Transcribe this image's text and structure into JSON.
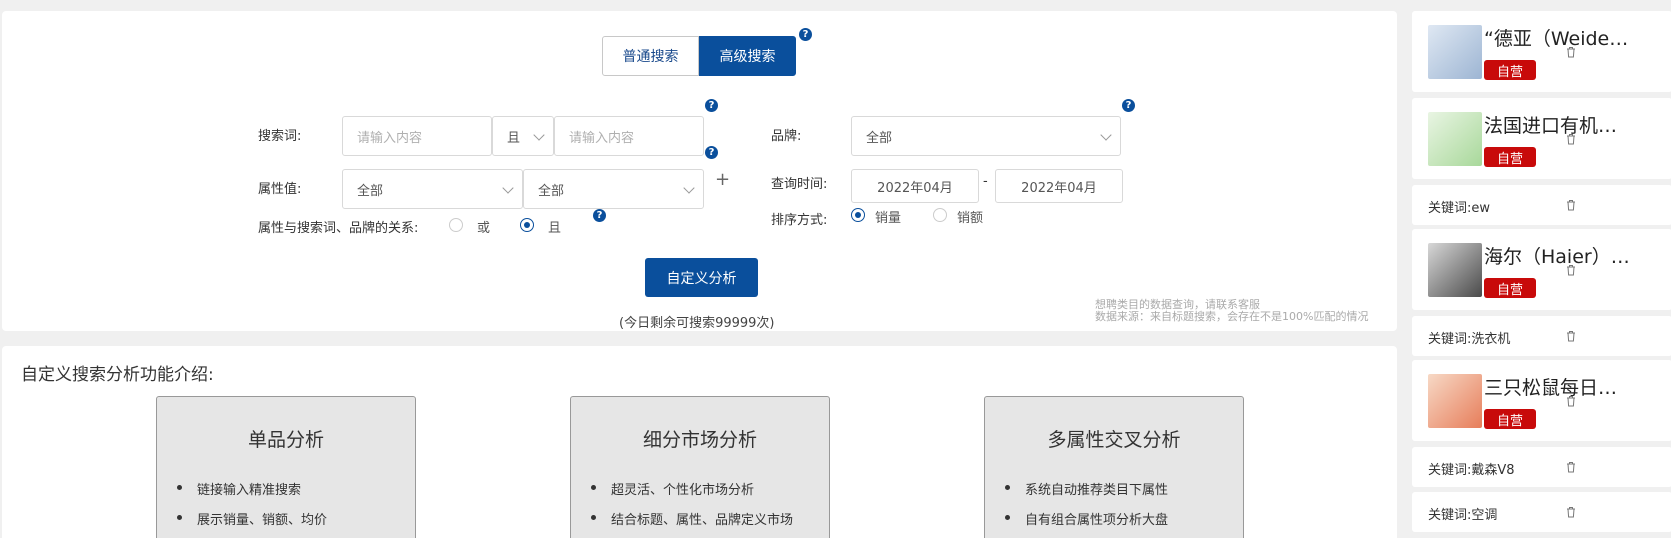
{
  "tabs": [
    {
      "label": "普通搜索",
      "active": false
    },
    {
      "label": "高级搜索",
      "active": true
    }
  ],
  "form": {
    "search_word": {
      "label": "搜索词:",
      "placeholder1": "请输入内容",
      "operator": "且",
      "placeholder2": "请输入内容"
    },
    "brand": {
      "label": "品牌:",
      "value": "全部"
    },
    "attribute": {
      "label": "属性值:",
      "value1": "全部",
      "value2": "全部"
    },
    "query_time": {
      "label": "查询时间:",
      "from": "2022年04月",
      "separator": "-",
      "to": "2022年04月"
    },
    "relation": {
      "label": "属性与搜索词、品牌的关系:",
      "options": [
        "或",
        "且"
      ],
      "selected": "且"
    },
    "sort": {
      "label": "排序方式:",
      "options": [
        "销量",
        "销额"
      ],
      "selected": "销量"
    },
    "submit_label": "自定义分析",
    "remaining": "(今日剩余可搜索99999次)",
    "note1": "想聘类目的数据查询，请联系客服",
    "note2": "数据来源：来自标题搜索，会存在不是100%匹配的情况"
  },
  "intro": {
    "title": "自定义搜索分析功能介绍:",
    "cards": [
      {
        "title": "单品分析",
        "items": [
          "链接输入精准搜索",
          "展示销量、销额、均价"
        ]
      },
      {
        "title": "细分市场分析",
        "items": [
          "超灵活、个性化市场分析",
          "结合标题、属性、品牌定义市场"
        ]
      },
      {
        "title": "多属性交叉分析",
        "items": [
          "系统自动推荐类目下属性",
          "自有组合属性项分析大盘"
        ]
      }
    ]
  },
  "history": [
    {
      "type": "product",
      "title": "“德亚（Weidendorf）德国原装进口",
      "badge": "自营"
    },
    {
      "type": "product",
      "title": "法国进口有机奶粉",
      "badge": "自营"
    },
    {
      "type": "keyword",
      "prefix": "关键词:",
      "keyword": "ew"
    },
    {
      "type": "product",
      "title": "海尔（Haier）洗衣机",
      "badge": "自营"
    },
    {
      "type": "keyword",
      "prefix": "关键词:",
      "keyword": "洗衣机"
    },
    {
      "type": "product",
      "title": "三只松鼠每日坚果",
      "badge": "自营"
    },
    {
      "type": "keyword",
      "prefix": "关键词:",
      "keyword": "戴森V8"
    },
    {
      "type": "keyword",
      "prefix": "关键词:",
      "keyword": "空调"
    }
  ],
  "colors": {
    "primary": "#0a4f9c",
    "badge": "#c80a0a"
  },
  "help_glyph": "?",
  "plus_glyph": "+"
}
